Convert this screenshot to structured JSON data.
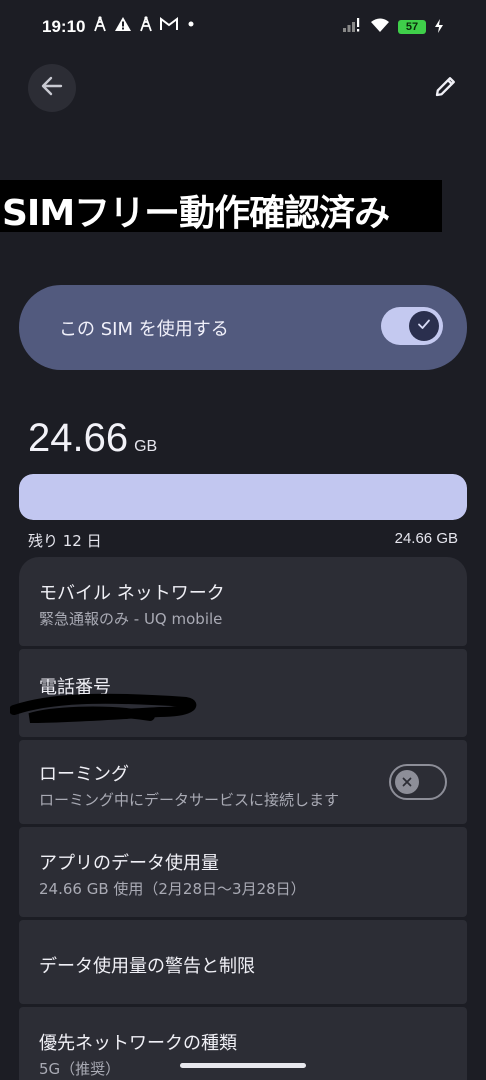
{
  "status_bar": {
    "time": "19:10",
    "battery": "57",
    "notification_icons": [
      "tower-icon",
      "warning-icon",
      "tower-icon",
      "gmail-icon",
      "dot-icon"
    ]
  },
  "toolbar": {
    "back_icon": "arrow-back-icon",
    "edit_icon": "pencil-icon"
  },
  "title_banner": {
    "text": "SIMフリー動作確認済み"
  },
  "use_sim": {
    "label": "この SIM を使用する",
    "enabled": true
  },
  "usage": {
    "amount": "24.66",
    "unit": "GB",
    "remaining_label": "残り 12 日",
    "limit_label": "24.66 GB",
    "fill_fraction": 1.0,
    "colors": {
      "fill": "#c2c7f0",
      "track": "#2b2c34"
    }
  },
  "settings": {
    "mobile_network": {
      "title": "モバイル ネットワーク",
      "summary": "緊急通報のみ - UQ mobile"
    },
    "phone_number": {
      "title": "電話番号"
    },
    "roaming": {
      "title": "ローミング",
      "summary": "ローミング中にデータサービスに接続します",
      "enabled": false
    },
    "app_data_usage": {
      "title": "アプリのデータ使用量",
      "summary": "24.66 GB 使用（2月28日〜3月28日）"
    },
    "data_warning": {
      "title": "データ使用量の警告と制限"
    },
    "preferred_network": {
      "title": "優先ネットワークの種類",
      "summary": "5G（推奨）"
    }
  }
}
